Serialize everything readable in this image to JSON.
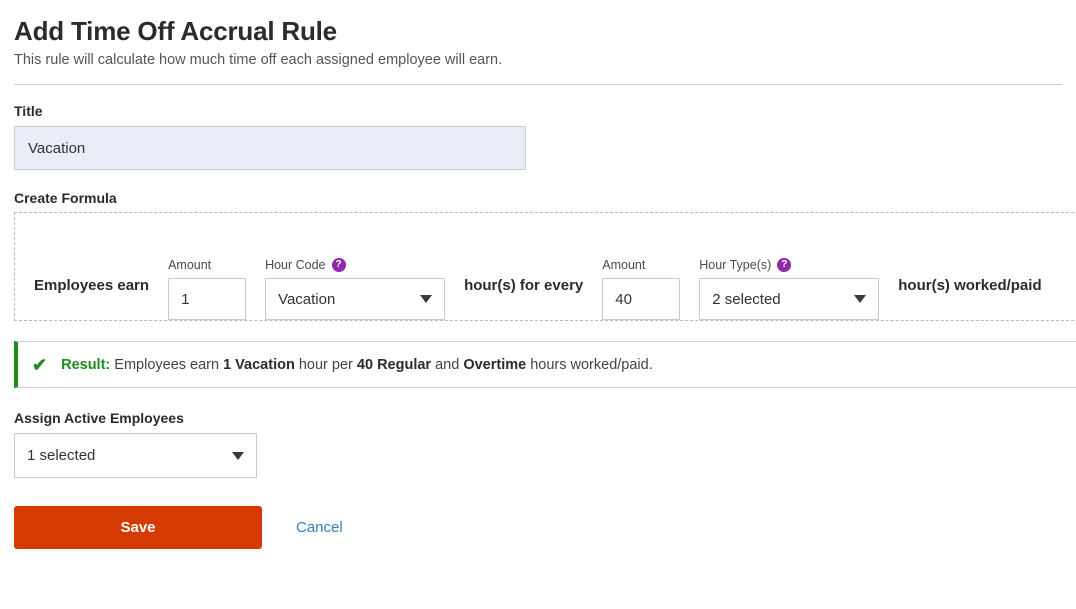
{
  "header": {
    "title": "Add Time Off Accrual Rule",
    "subtitle": "This rule will calculate how much time off each assigned employee will earn."
  },
  "title_field": {
    "label": "Title",
    "value": "Vacation",
    "placeholder": "Title"
  },
  "formula": {
    "section_label": "Create Formula",
    "lead_text": "Employees earn",
    "amount_label_1": "Amount",
    "amount_value_1": "1",
    "hour_code_label": "Hour Code",
    "hour_code_value": "Vacation",
    "hour_code_help": "?",
    "middle_text": "hour(s) for every",
    "amount_label_2": "Amount",
    "amount_value_2": "40",
    "hour_type_label": "Hour Type(s)",
    "hour_type_value": "2 selected",
    "hour_type_help": "?",
    "trailing_text": "hour(s) worked/paid"
  },
  "result": {
    "check": "✔",
    "label": "Result:",
    "part1": " Employees earn ",
    "bold1": "1 Vacation",
    "part2": " hour per ",
    "bold2": "40 Regular",
    "part3": " and ",
    "bold3": "Overtime",
    "part4": " hours worked/paid."
  },
  "assign": {
    "label": "Assign Active Employees",
    "value": "1 selected"
  },
  "actions": {
    "save_label": "Save",
    "cancel_label": "Cancel"
  },
  "colors": {
    "save_button": "#d53a00",
    "cancel_link": "#3b7dbd",
    "result_green": "#1e8c1e",
    "help_purple": "#8e2aa8",
    "title_field_bg": "#e8edf8"
  }
}
